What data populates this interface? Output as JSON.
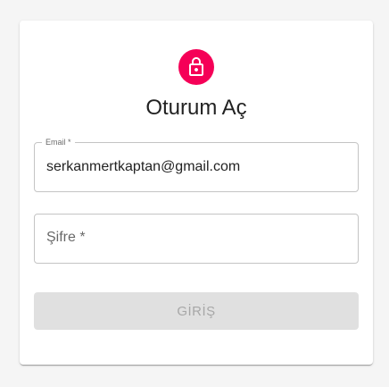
{
  "login": {
    "title": "Oturum Aç",
    "avatar_icon": "lock-icon",
    "email": {
      "label": "Email *",
      "value": "serkanmertkaptan@gmail.com"
    },
    "password": {
      "label": "Şifre *",
      "value": ""
    },
    "submit_label": "GİRİŞ"
  },
  "colors": {
    "accent": "#f50057",
    "page_background": "#f5f5f5",
    "card_background": "#ffffff",
    "disabled_button": "#e0e0e0"
  }
}
